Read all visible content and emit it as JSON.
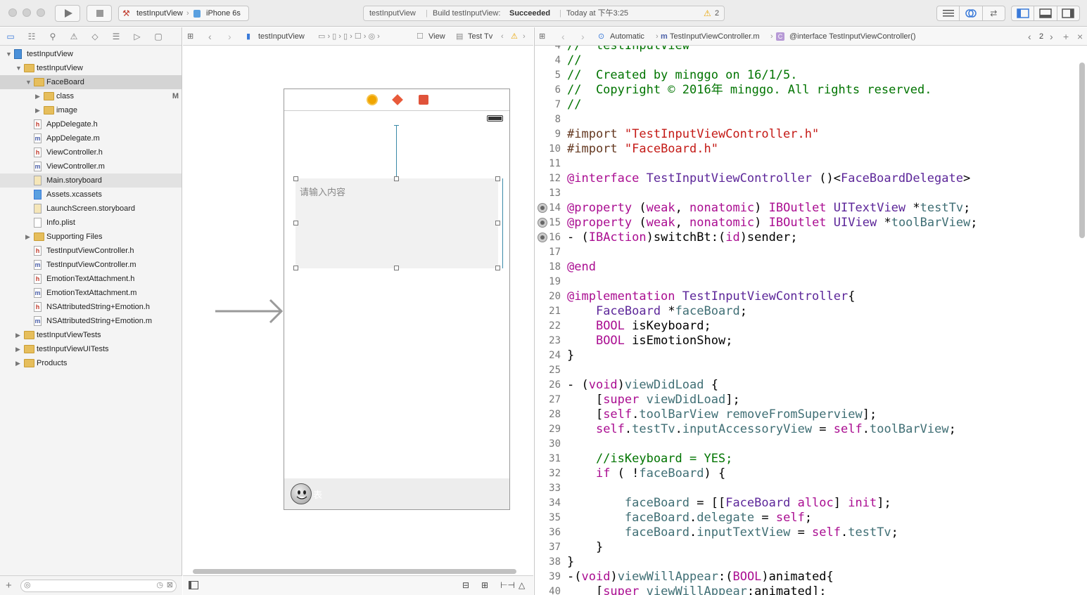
{
  "toolbar": {
    "scheme_project": "testInputView",
    "scheme_device": "iPhone 6s",
    "activity_project": "testInputView",
    "activity_status_prefix": "Build testInputView:",
    "activity_status": "Succeeded",
    "activity_time": "Today at 下午3:25",
    "warning_count": "2"
  },
  "navigator": {
    "items": [
      {
        "label": "testInputView",
        "kind": "project",
        "depth": 0,
        "open": true
      },
      {
        "label": "testInputView",
        "kind": "folder",
        "depth": 1,
        "open": true
      },
      {
        "label": "FaceBoard",
        "kind": "folder",
        "depth": 2,
        "open": true,
        "selected": true
      },
      {
        "label": "class",
        "kind": "folder",
        "depth": 3,
        "open": false,
        "badge": "M"
      },
      {
        "label": "image",
        "kind": "folder",
        "depth": 3,
        "open": false
      },
      {
        "label": "AppDelegate.h",
        "kind": "h",
        "depth": 2
      },
      {
        "label": "AppDelegate.m",
        "kind": "m",
        "depth": 2
      },
      {
        "label": "ViewController.h",
        "kind": "h",
        "depth": 2
      },
      {
        "label": "ViewController.m",
        "kind": "m",
        "depth": 2
      },
      {
        "label": "Main.storyboard",
        "kind": "storyboard",
        "depth": 2,
        "active": true
      },
      {
        "label": "Assets.xcassets",
        "kind": "assets",
        "depth": 2
      },
      {
        "label": "LaunchScreen.storyboard",
        "kind": "storyboard",
        "depth": 2
      },
      {
        "label": "Info.plist",
        "kind": "plist",
        "depth": 2
      },
      {
        "label": "Supporting Files",
        "kind": "folder",
        "depth": 2,
        "open": false
      },
      {
        "label": "TestInputViewController.h",
        "kind": "h",
        "depth": 2
      },
      {
        "label": "TestInputViewController.m",
        "kind": "m",
        "depth": 2
      },
      {
        "label": "EmotionTextAttachment.h",
        "kind": "h",
        "depth": 2
      },
      {
        "label": "EmotionTextAttachment.m",
        "kind": "m",
        "depth": 2
      },
      {
        "label": "NSAttributedString+Emotion.h",
        "kind": "h",
        "depth": 2
      },
      {
        "label": "NSAttributedString+Emotion.m",
        "kind": "m",
        "depth": 2
      },
      {
        "label": "testInputViewTests",
        "kind": "folder",
        "depth": 1,
        "open": false
      },
      {
        "label": "testInputViewUITests",
        "kind": "folder",
        "depth": 1,
        "open": false
      },
      {
        "label": "Products",
        "kind": "folder",
        "depth": 1,
        "open": false
      }
    ]
  },
  "storyboard": {
    "jump_project": "testInputView",
    "jump_view": "View",
    "jump_control": "Test Tv",
    "placeholder": "请输入内容",
    "toolbar_label": "表"
  },
  "editor": {
    "jump_mode": "Automatic",
    "jump_file": "TestInputViewController.m",
    "jump_symbol": "@interface TestInputViewController()",
    "counterpart_count": "2",
    "lines": [
      {
        "n": "4",
        "t": "//  testInputView"
      },
      {
        "n": "4",
        "t": "//"
      },
      {
        "n": "5",
        "t": "//  Created by minggo on 16/1/5."
      },
      {
        "n": "6",
        "t": "//  Copyright © 2016年 minggo. All rights reserved."
      },
      {
        "n": "7",
        "t": "//"
      },
      {
        "n": "8",
        "t": ""
      },
      {
        "n": "9",
        "t": "#import \"TestInputViewController.h\""
      },
      {
        "n": "10",
        "t": "#import \"FaceBoard.h\""
      },
      {
        "n": "11",
        "t": ""
      },
      {
        "n": "12",
        "t": "@interface TestInputViewController ()<FaceBoardDelegate>"
      },
      {
        "n": "13",
        "t": ""
      },
      {
        "n": "14",
        "t": "@property (weak, nonatomic) IBOutlet UITextView *testTv;"
      },
      {
        "n": "15",
        "t": "@property (weak, nonatomic) IBOutlet UIView *toolBarView;"
      },
      {
        "n": "16",
        "t": "- (IBAction)switchBt:(id)sender;"
      },
      {
        "n": "17",
        "t": ""
      },
      {
        "n": "18",
        "t": "@end"
      },
      {
        "n": "19",
        "t": ""
      },
      {
        "n": "20",
        "t": "@implementation TestInputViewController{"
      },
      {
        "n": "21",
        "t": "    FaceBoard *faceBoard;"
      },
      {
        "n": "22",
        "t": "    BOOL isKeyboard;"
      },
      {
        "n": "23",
        "t": "    BOOL isEmotionShow;"
      },
      {
        "n": "24",
        "t": "}"
      },
      {
        "n": "25",
        "t": ""
      },
      {
        "n": "26",
        "t": "- (void)viewDidLoad {"
      },
      {
        "n": "27",
        "t": "    [super viewDidLoad];"
      },
      {
        "n": "28",
        "t": "    [self.toolBarView removeFromSuperview];"
      },
      {
        "n": "29",
        "t": "    self.testTv.inputAccessoryView = self.toolBarView;"
      },
      {
        "n": "30",
        "t": ""
      },
      {
        "n": "31",
        "t": "    //isKeyboard = YES;"
      },
      {
        "n": "32",
        "t": "    if ( !faceBoard) {"
      },
      {
        "n": "33",
        "t": ""
      },
      {
        "n": "34",
        "t": "        faceBoard = [[FaceBoard alloc] init];"
      },
      {
        "n": "35",
        "t": "        faceBoard.delegate = self;"
      },
      {
        "n": "36",
        "t": "        faceBoard.inputTextView = self.testTv;"
      },
      {
        "n": "37",
        "t": "    }"
      },
      {
        "n": "38",
        "t": "}"
      },
      {
        "n": "39",
        "t": "-(void)viewWillAppear:(BOOL)animated{"
      },
      {
        "n": "40",
        "t": "    [super viewWillAppear:animated];"
      }
    ]
  }
}
